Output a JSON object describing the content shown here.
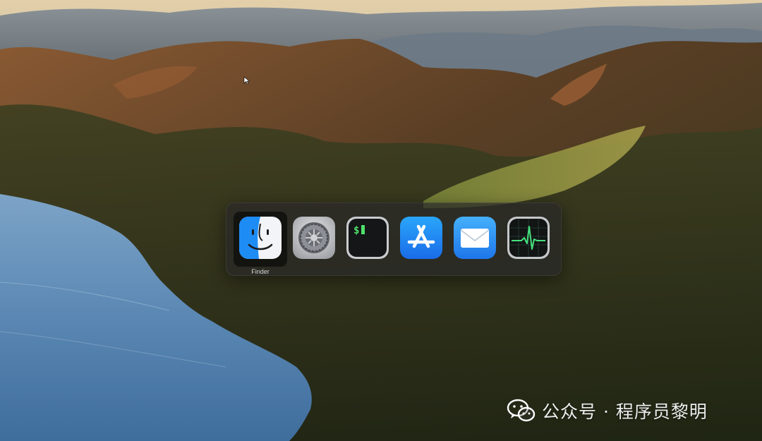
{
  "desktop": {
    "wallpaper_name": "macOS hills and lake wallpaper"
  },
  "app_switcher": {
    "selected_index": 0,
    "apps": [
      {
        "name": "Finder",
        "icon": "finder-icon",
        "label": "Finder"
      },
      {
        "name": "System Settings",
        "icon": "settings-gear-icon",
        "label": ""
      },
      {
        "name": "Terminal",
        "icon": "terminal-icon",
        "label": ""
      },
      {
        "name": "App Store",
        "icon": "app-store-icon",
        "label": ""
      },
      {
        "name": "Mail",
        "icon": "mail-icon",
        "label": ""
      },
      {
        "name": "Activity Monitor",
        "icon": "activity-monitor-icon",
        "label": ""
      }
    ]
  },
  "watermark": {
    "text": "公众号 · 程序员黎明",
    "icon": "wechat-icon"
  },
  "colors": {
    "finder_blue": "#1e8cf5",
    "appstore_blue": "#1a7cf0",
    "mail_blue": "#2f8ef7",
    "switcher_bg": "#282828"
  }
}
